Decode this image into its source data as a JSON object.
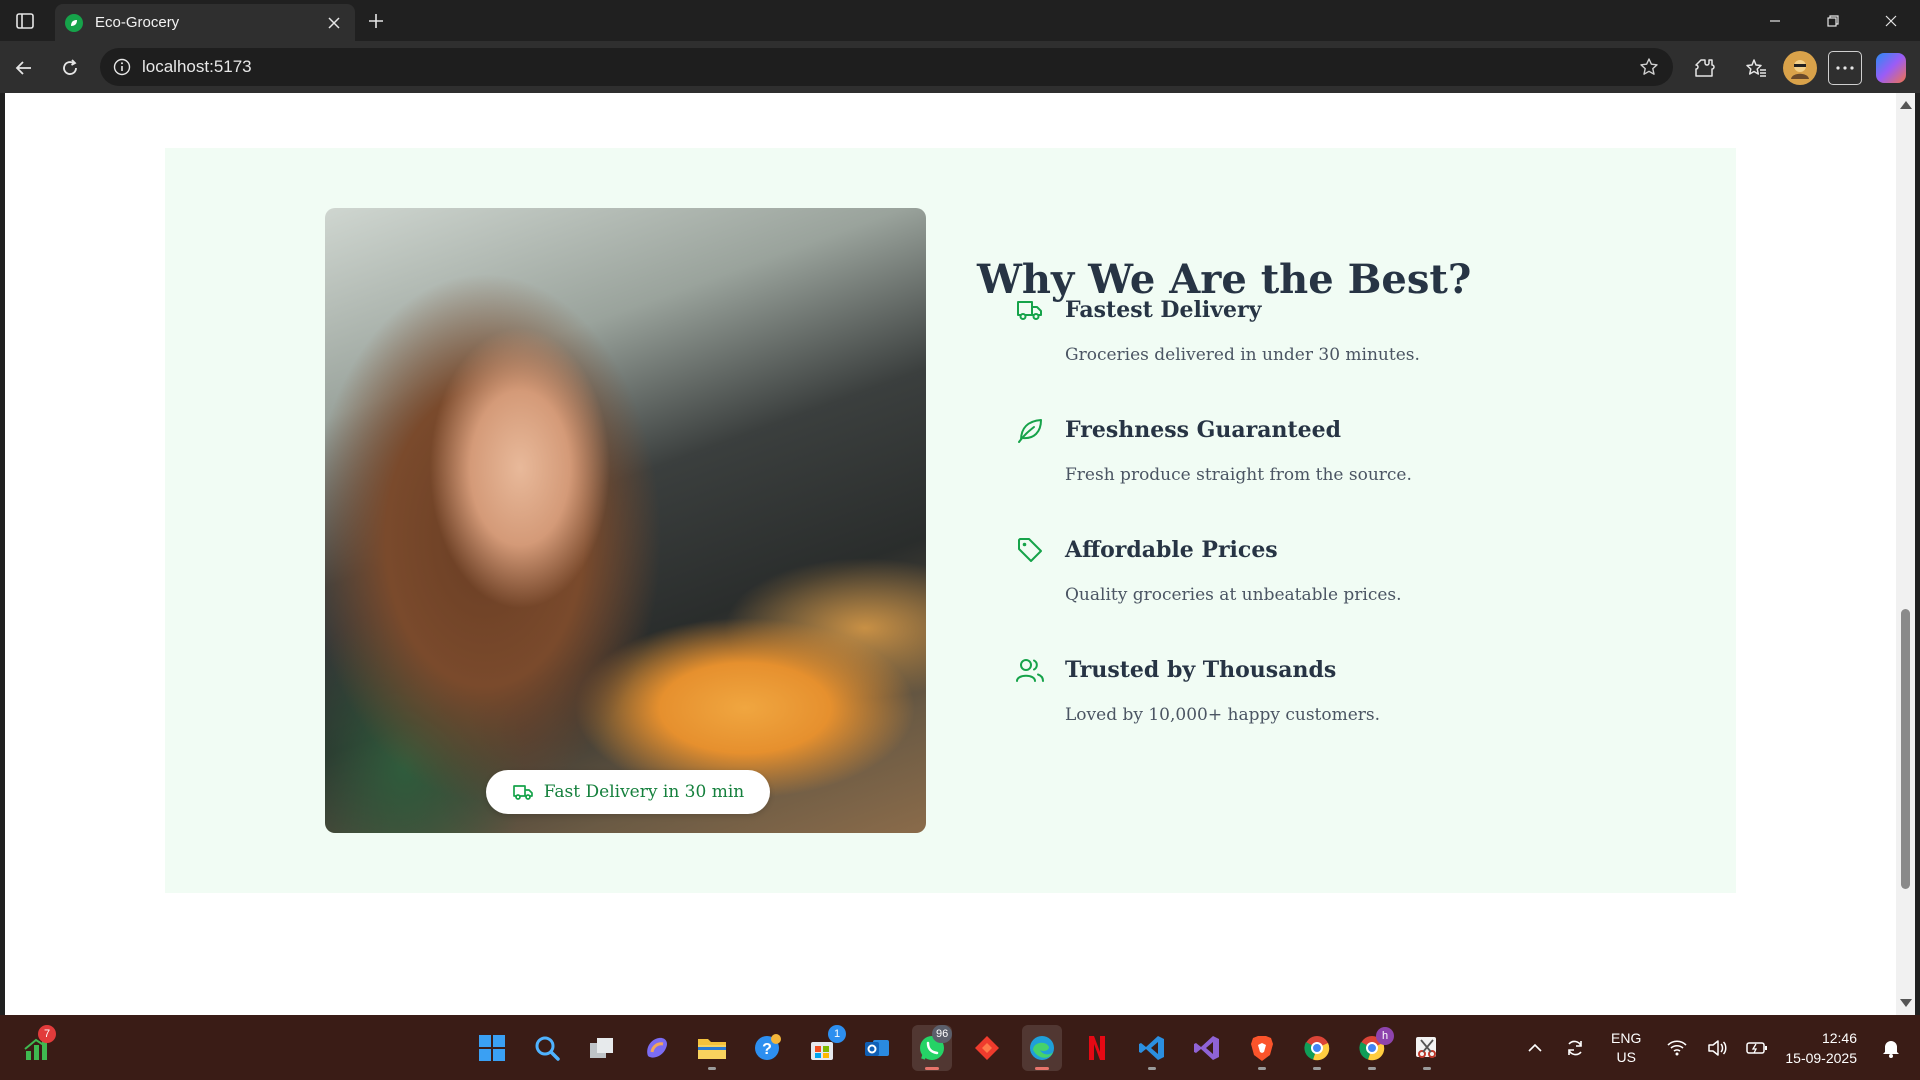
{
  "browser": {
    "tab_title": "Eco-Grocery",
    "url": "localhost:5173"
  },
  "page": {
    "heading": "Why We Are the Best?",
    "photo_badge": "Fast Delivery in 30 min",
    "features": [
      {
        "icon": "truck-icon",
        "title": "Fastest Delivery",
        "description": "Groceries delivered in under 30 minutes."
      },
      {
        "icon": "leaf-icon",
        "title": "Freshness Guaranteed",
        "description": "Fresh produce straight from the source."
      },
      {
        "icon": "tag-icon",
        "title": "Affordable Prices",
        "description": "Quality groceries at unbeatable prices."
      },
      {
        "icon": "users-icon",
        "title": "Trusted by Thousands",
        "description": "Loved by 10,000+ happy customers."
      }
    ]
  },
  "colors": {
    "accent_green": "#16a34a",
    "section_bg": "#f1fcf4",
    "heading": "#273444"
  },
  "taskbar": {
    "widget_badge": "7",
    "whatsapp_badge": "96",
    "store_badge": "1",
    "chrome_badge": "h",
    "apps": [
      "windows-start-icon",
      "search-icon",
      "task-view-icon",
      "copilot-icon",
      "file-explorer-icon",
      "help-icon",
      "microsoft-store-icon",
      "outlook-icon",
      "whatsapp-icon",
      "anydesk-icon",
      "edge-icon",
      "netflix-icon",
      "vscode-icon",
      "visual-studio-icon",
      "brave-icon",
      "chrome-icon",
      "chrome-profile-icon",
      "snipping-tool-icon"
    ],
    "language_line1": "ENG",
    "language_line2": "US",
    "time": "12:46",
    "date": "15-09-2025"
  }
}
